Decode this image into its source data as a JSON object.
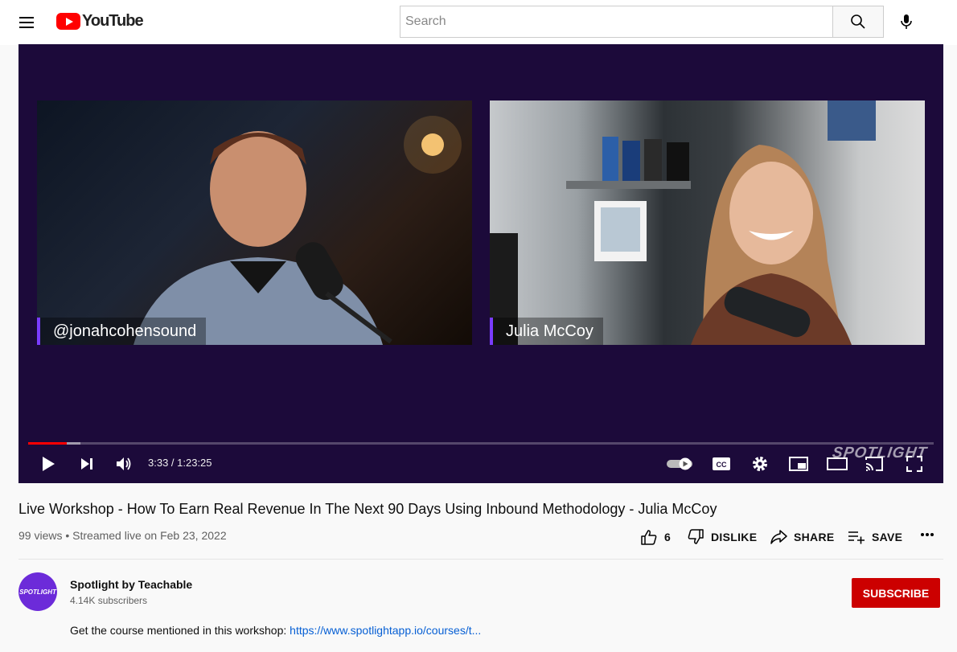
{
  "masthead": {
    "logo_text": "YouTube",
    "search_placeholder": "Search"
  },
  "player": {
    "left_cam_label": "@jonahcohensound",
    "right_cam_label": "Julia McCoy",
    "time_display": "3:33 / 1:23:25",
    "progress_fraction": 0.0426,
    "buffered_fraction": 0.058,
    "watermark": "SPOTLIGHT",
    "cc_label": "CC"
  },
  "video": {
    "title": "Live Workshop - How To Earn Real Revenue In The Next 90 Days Using Inbound Methodology - Julia McCoy",
    "meta": "99 views • Streamed live on Feb 23, 2022",
    "like_count": "6",
    "dislike_label": "DISLIKE",
    "share_label": "SHARE",
    "save_label": "SAVE"
  },
  "channel": {
    "avatar_text": "SPOTLIGHT",
    "name": "Spotlight by Teachable",
    "subscribers": "4.14K subscribers",
    "subscribe_label": "SUBSCRIBE"
  },
  "description": {
    "text": "Get the course mentioned in this workshop: ",
    "link": "https://www.spotlightapp.io/courses/t..."
  },
  "colors": {
    "brand_red": "#ff0000",
    "subscribe_red": "#cc0000",
    "player_bg": "#1c0a3a",
    "label_accent": "#7a3cff",
    "link_blue": "#065fd4"
  }
}
